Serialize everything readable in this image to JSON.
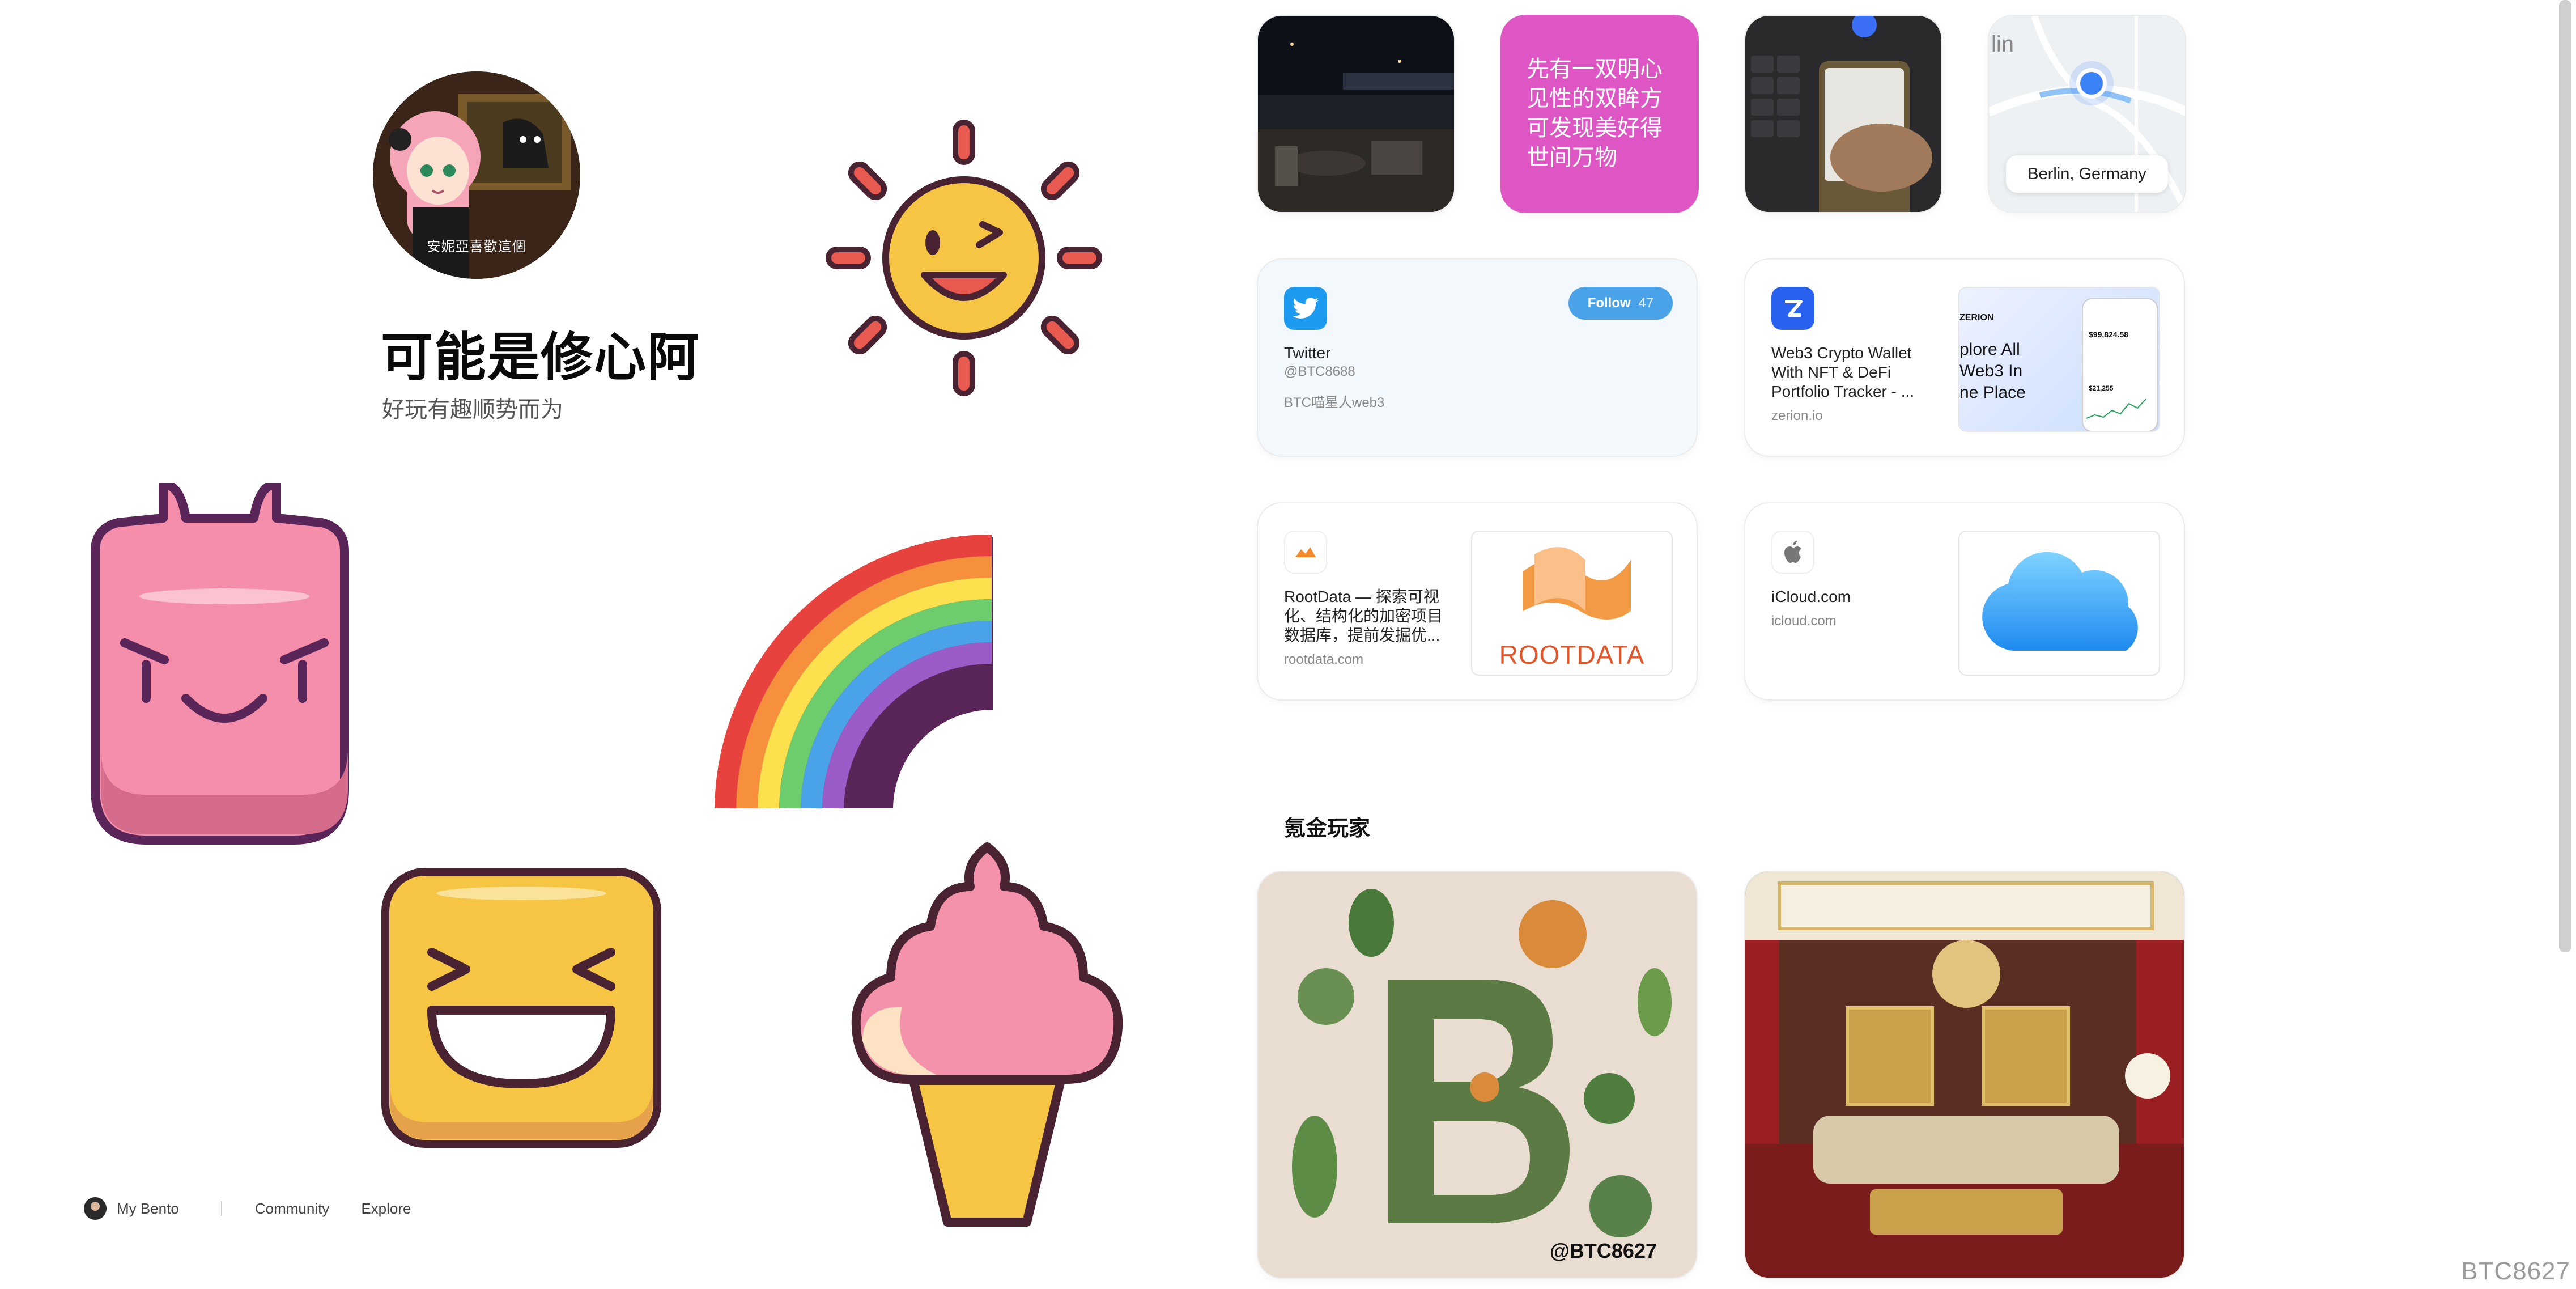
{
  "profile": {
    "avatar_caption": "安妮亞喜歡這個",
    "name": "可能是修心阿",
    "bio": "好玩有趣顺势而为"
  },
  "stickers": [
    "sun-sticker",
    "devil-sticker",
    "rainbow-sticker",
    "laughing-face-sticker",
    "ice-cream-sticker"
  ],
  "quote_card": {
    "text": "先有一双明心见性的双眸方可发现美好得世间万物",
    "color": "#de56c4"
  },
  "map_card": {
    "label": "Berlin, Germany",
    "corner_text": "lin"
  },
  "twitter_card": {
    "title": "Twitter",
    "handle": "@BTC8688",
    "bio": "BTC喵星人web3",
    "follow_label": "Follow",
    "follow_count": "47",
    "accent": "#1d9bf0"
  },
  "zerion_card": {
    "title": "Web3 Crypto Wallet With NFT & DeFi Portfolio Tracker - ...",
    "url": "zerion.io",
    "preview_brand": "ZERION",
    "preview_text": "plore All Web3 In ne Place",
    "preview_amount": "$99,824.58",
    "preview_amount2": "$21,255"
  },
  "rootdata_card": {
    "title": "RootData — 探索可视化、结构化的加密项目数据库，提前发掘优...",
    "url": "rootdata.com",
    "preview_logo": "ROOTDATA"
  },
  "icloud_card": {
    "title": "iCloud.com",
    "url": "icloud.com"
  },
  "section": {
    "heading": "氪金玩家"
  },
  "image_cards": {
    "b_watermark": "@BTC8627"
  },
  "footer": {
    "my_bento": "My Bento",
    "community": "Community",
    "explore": "Explore"
  },
  "page_watermark": "BTC8627"
}
